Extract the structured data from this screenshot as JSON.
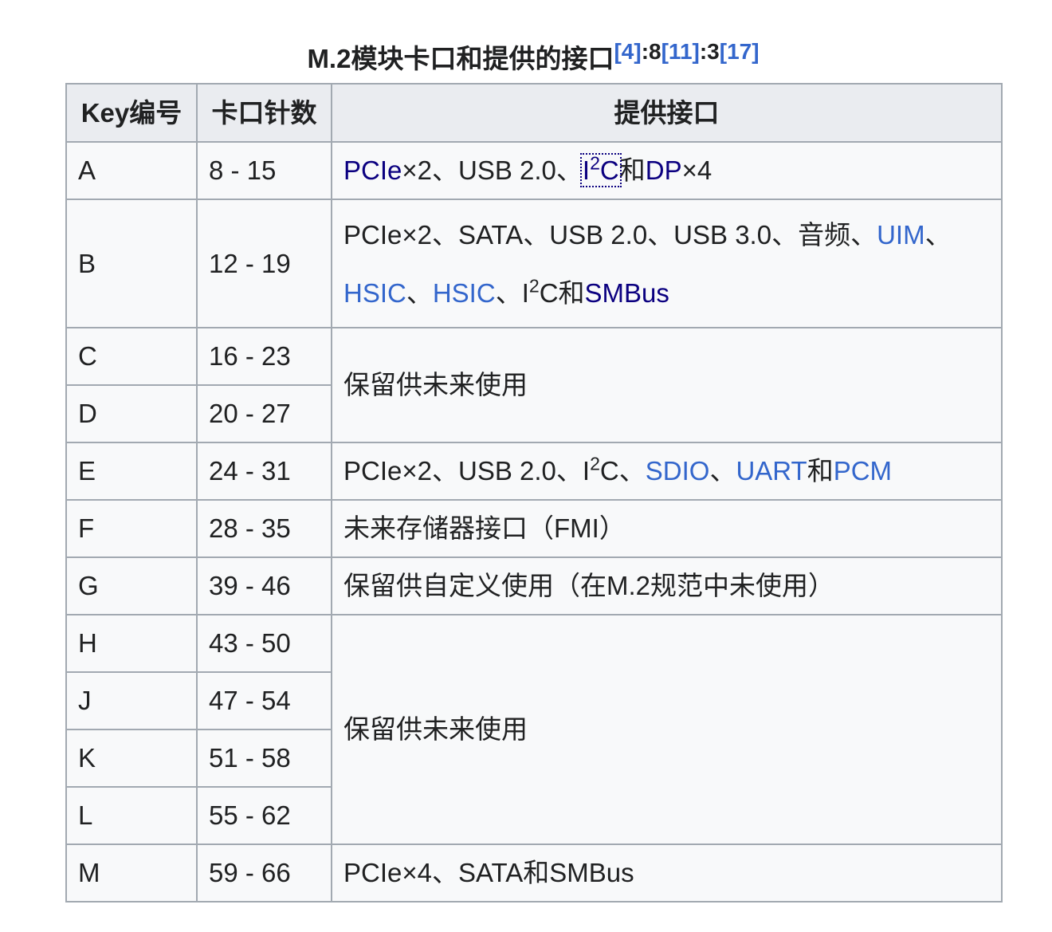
{
  "caption": {
    "title": "M.2模块卡口和提供的接口",
    "refs": [
      {
        "label": "[4]",
        "page": ":8"
      },
      {
        "label": "[11]",
        "page": ":3"
      },
      {
        "label": "[17]"
      }
    ]
  },
  "headers": {
    "key": "Key编号",
    "pins": "卡口针数",
    "interfaces": "提供接口"
  },
  "rows": [
    {
      "key": "A",
      "pins": "8 - 15",
      "interfaces": [
        {
          "text": "PCIe"
        },
        {
          "text": "×2、USB 2.0、"
        },
        {
          "text": "I",
          "sup": "2",
          "after": "C"
        },
        {
          "text": "和"
        },
        {
          "text": "DP"
        },
        {
          "text": "×4"
        }
      ]
    },
    {
      "key": "B",
      "pins": "12 - 19",
      "interfaces": [
        {
          "text": "PCIe×2、SATA、USB 2.0、USB 3.0、音频、"
        },
        {
          "text": "UIM"
        },
        {
          "text": "、"
        },
        {
          "text": "HSIC"
        },
        {
          "text": "、"
        },
        {
          "text": "HSIC"
        },
        {
          "text": "、I",
          "sup": "2",
          "after": "C和"
        },
        {
          "text": "SMBus"
        }
      ]
    },
    {
      "key": "C",
      "pins": "16 - 23",
      "interfaces": [
        {
          "text": "保留供未来使用"
        }
      ]
    },
    {
      "key": "D",
      "pins": "20 - 27"
    },
    {
      "key": "E",
      "pins": "24 - 31",
      "interfaces": [
        {
          "text": "PCIe×2、USB 2.0、I",
          "sup": "2",
          "after": "C、"
        },
        {
          "text": "SDIO"
        },
        {
          "text": "、"
        },
        {
          "text": "UART"
        },
        {
          "text": "和"
        },
        {
          "text": "PCM"
        }
      ]
    },
    {
      "key": "F",
      "pins": "28 - 35",
      "interfaces": [
        {
          "text": "未来存储器接口（FMI）"
        }
      ]
    },
    {
      "key": "G",
      "pins": "39 - 46",
      "interfaces": [
        {
          "text": "保留供自定义使用（在M.2规范中未使用）"
        }
      ]
    },
    {
      "key": "H",
      "pins": "43 - 50",
      "interfaces": [
        {
          "text": "保留供未来使用"
        }
      ]
    },
    {
      "key": "J",
      "pins": "47 - 54"
    },
    {
      "key": "K",
      "pins": "51 - 58"
    },
    {
      "key": "L",
      "pins": "55 - 62"
    },
    {
      "key": "M",
      "pins": "59 - 66",
      "interfaces": [
        {
          "text": "PCIe×4、SATA和SMBus"
        }
      ]
    }
  ],
  "colors": {
    "text": "#202122",
    "link": "#3366cc",
    "link_visited": "#0b0080",
    "header_background": "#eaecf0",
    "cell_background": "#f8f9fa",
    "border": "#a2a9b1"
  }
}
